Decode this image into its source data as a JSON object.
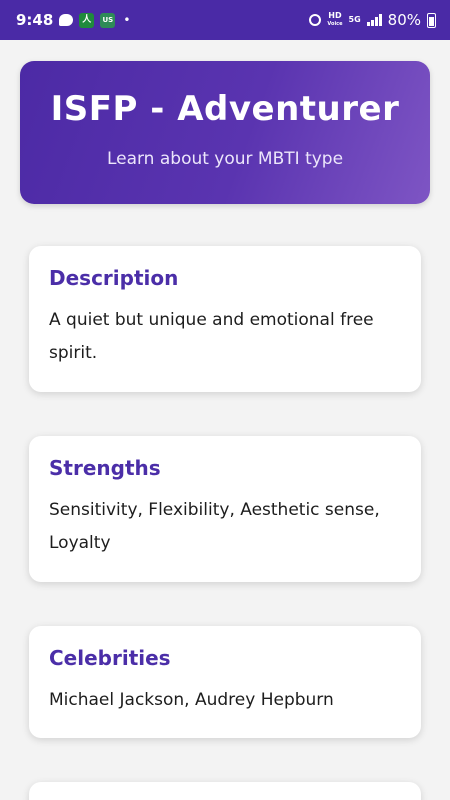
{
  "status_bar": {
    "time": "9:48",
    "app_icon_letter": "人",
    "us_badge": "US",
    "dot": "•",
    "hd_top": "HD",
    "hd_bottom": "Voice",
    "net": "5G",
    "battery": "80%"
  },
  "header": {
    "title": "ISFP - Adventurer",
    "subtitle": "Learn about your MBTI type"
  },
  "sections": [
    {
      "title": "Description",
      "body": "A quiet but unique and emotional free spirit."
    },
    {
      "title": "Strengths",
      "body": "Sensitivity, Flexibility, Aesthetic sense, Loyalty"
    },
    {
      "title": "Celebrities",
      "body": "Michael Jackson, Audrey Hepburn"
    }
  ],
  "colors": {
    "accent": "#4b2ea8",
    "status_bar": "#4a2aa6",
    "background": "#f3f3f3"
  }
}
